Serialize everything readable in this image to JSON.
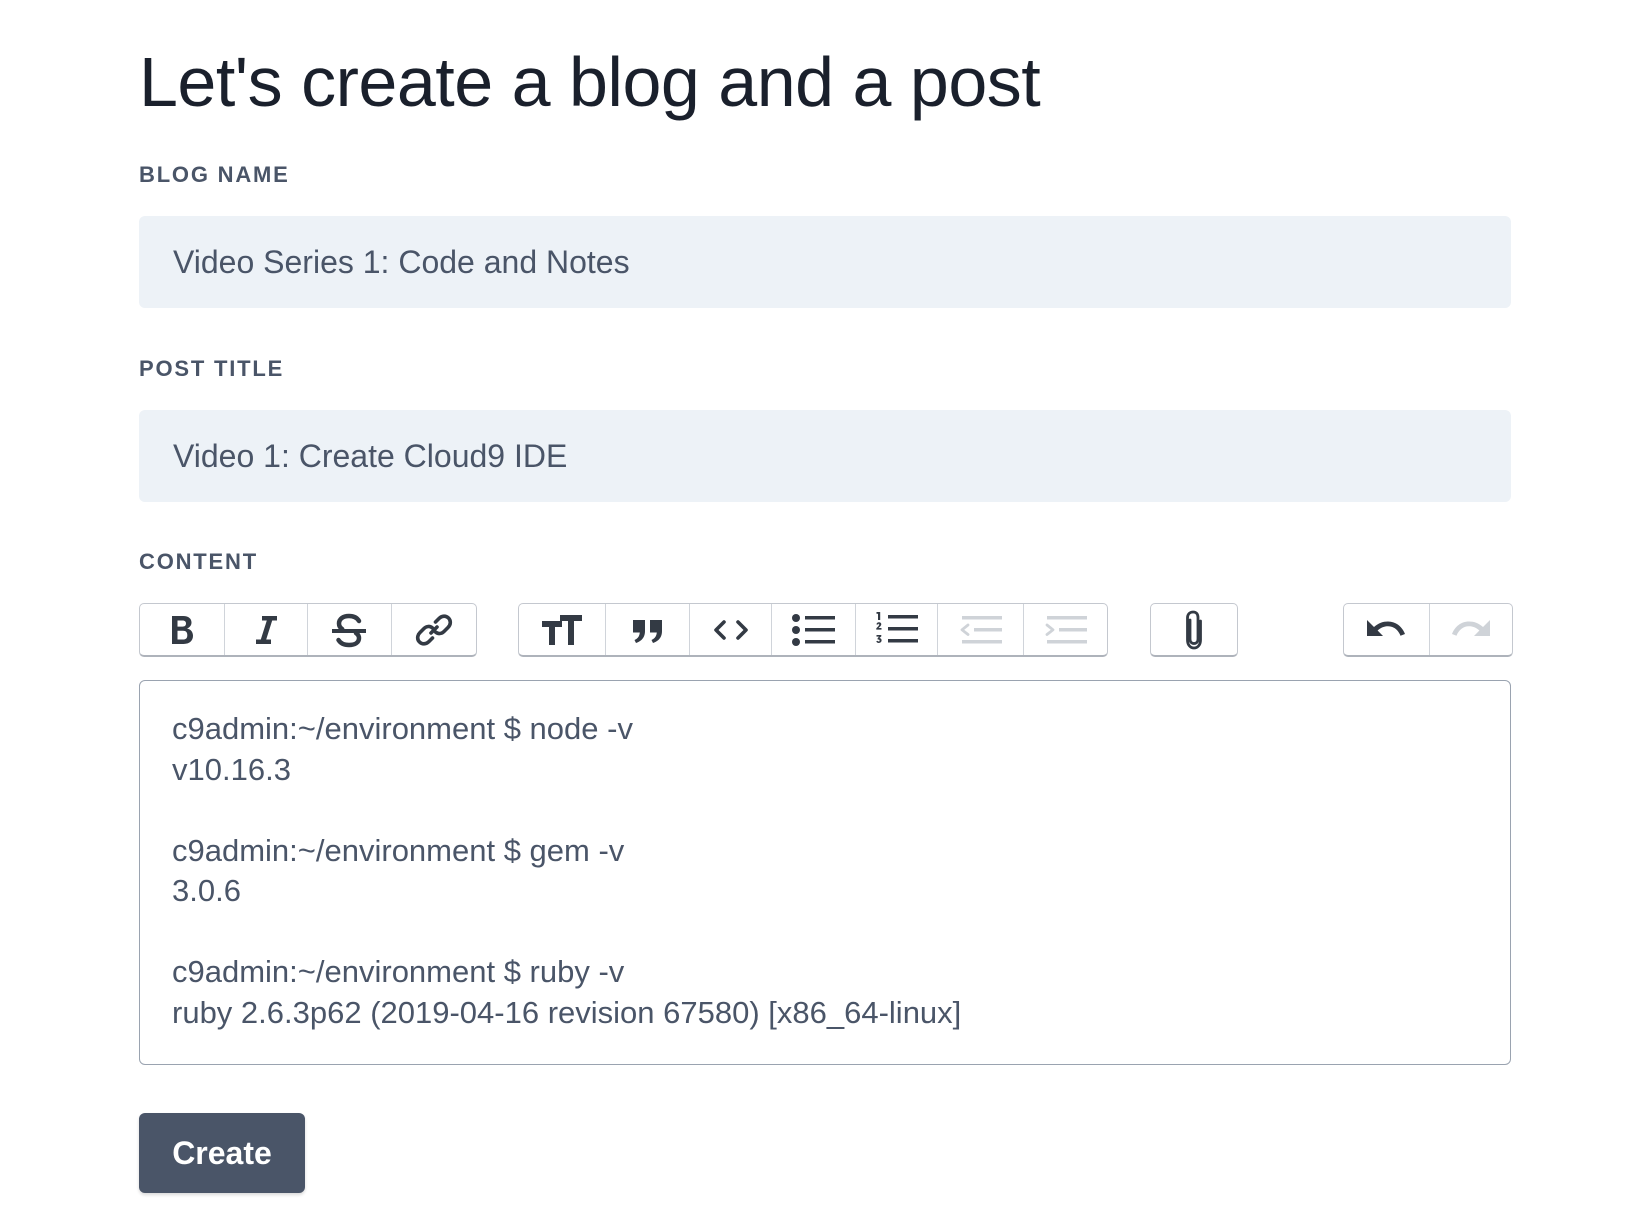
{
  "page": {
    "title": "Let's create a blog and a post"
  },
  "form": {
    "blog_name": {
      "label": "Blog Name",
      "value": "Video Series 1: Code and Notes"
    },
    "post_title": {
      "label": "Post Title",
      "value": "Video 1: Create Cloud9 IDE"
    },
    "content": {
      "label": "Content",
      "lines": [
        "c9admin:~/environment $ node -v",
        "v10.16.3",
        "",
        "c9admin:~/environment $ gem -v",
        "3.0.6",
        "",
        "c9admin:~/environment $ ruby -v",
        "ruby 2.6.3p62 (2019-04-16 revision 67580) [x86_64-linux]"
      ]
    },
    "submit_label": "Create"
  },
  "toolbar": {
    "groups": [
      {
        "name": "text-tools",
        "buttons": [
          "bold-icon",
          "italic-icon",
          "strikethrough-icon",
          "link-icon"
        ]
      },
      {
        "name": "block-tools",
        "buttons": [
          "heading-icon",
          "quote-icon",
          "code-icon",
          "bullet-list-icon",
          "number-list-icon",
          "decrease-indent-icon",
          "increase-indent-icon"
        ]
      },
      {
        "name": "file-tools",
        "buttons": [
          "attach-files-icon"
        ]
      },
      {
        "name": "history-tools",
        "buttons": [
          "undo-icon",
          "redo-icon"
        ]
      }
    ],
    "disabled_buttons": [
      "decrease-indent-icon",
      "increase-indent-icon",
      "redo-icon"
    ]
  },
  "colors": {
    "heading": "#1a202c",
    "label": "#4a5568",
    "field_background": "#edf2f7",
    "button_background": "#4a5568",
    "button_text": "#ffffff",
    "icon_active": "#333a44",
    "icon_disabled": "#cfd3d8"
  }
}
